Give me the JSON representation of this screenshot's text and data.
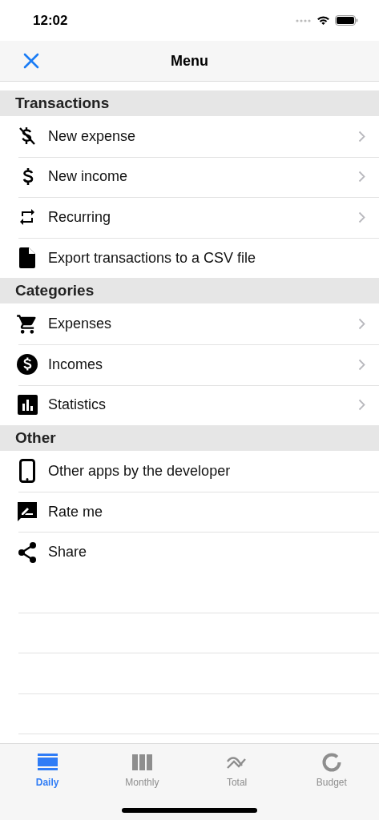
{
  "status_bar": {
    "time": "12:02"
  },
  "nav_bar": {
    "title": "Menu"
  },
  "sections": [
    {
      "title": "Transactions",
      "items": [
        {
          "label": "New expense",
          "kind": "no-dollar",
          "chevron": true
        },
        {
          "label": "New income",
          "kind": "dollar",
          "chevron": true
        },
        {
          "label": "Recurring",
          "kind": "repeat",
          "chevron": true
        },
        {
          "label": "Export transactions to a CSV file",
          "kind": "file",
          "chevron": false
        }
      ]
    },
    {
      "title": "Categories",
      "items": [
        {
          "label": "Expenses",
          "kind": "cart",
          "chevron": true
        },
        {
          "label": "Incomes",
          "kind": "coin",
          "chevron": true
        },
        {
          "label": "Statistics",
          "kind": "chart",
          "chevron": true
        }
      ]
    },
    {
      "title": "Other",
      "items": [
        {
          "label": "Other apps by the developer",
          "kind": "phone",
          "chevron": false
        },
        {
          "label": "Rate me",
          "kind": "rate",
          "chevron": false
        },
        {
          "label": "Share",
          "kind": "share",
          "chevron": false
        }
      ]
    }
  ],
  "tab_bar": [
    {
      "label": "Daily",
      "kind": "daily",
      "selected": true
    },
    {
      "label": "Monthly",
      "kind": "monthly",
      "selected": false
    },
    {
      "label": "Total",
      "kind": "total",
      "selected": false
    },
    {
      "label": "Budget",
      "kind": "budget",
      "selected": false
    }
  ]
}
